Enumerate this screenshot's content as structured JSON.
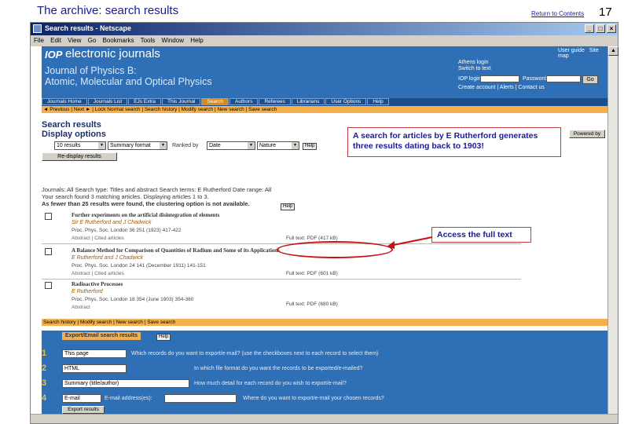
{
  "slide": {
    "title": "The archive: search results",
    "return_link": "Return to Contents",
    "page_number": "17"
  },
  "browser": {
    "window_title": "Search results - Netscape",
    "menu": [
      "File",
      "Edit",
      "View",
      "Go",
      "Bookmarks",
      "Tools",
      "Window",
      "Help"
    ]
  },
  "site": {
    "logo": "IOP",
    "brand": "electronic journals",
    "journal_line1": "Journal of Physics B:",
    "journal_line2": "Atomic, Molecular and Optical Physics",
    "top_links": [
      "User guide",
      "Site map"
    ],
    "login": {
      "heading": "Athens login",
      "switch": "Switch to text",
      "iop_login": "IOP login:",
      "password": "Password:",
      "go": "Go",
      "create": "Create account | Alerts | Contact us"
    }
  },
  "nav": {
    "tabs": [
      "Journals Home",
      "Journals List",
      "EJs Extra",
      "This Journal",
      "Search",
      "Authors",
      "Referees",
      "Librarians",
      "User Options",
      "Help"
    ],
    "active_tab": "Search",
    "subnav": "◄ Previous | Next ► | Lock Normal search | Search history | Modify search | New search | Save search"
  },
  "results": {
    "heading": "Search results",
    "display_heading": "Display options",
    "results_select": "10 results",
    "format_select": "Summary format",
    "ranked_label": "Ranked by",
    "rank_select": "Date",
    "order_select": "Nature",
    "help": "Help",
    "redisplay_button": "Re-display results",
    "powered_by": "Powered by",
    "summary_line1": "Journals: All  Search type: Titles and abstract  Search terms: E Rutherford  Date range: All",
    "summary_line2": "Your search found 3 matching articles. Displaying articles 1 to 3.",
    "summary_line3": "As fewer than 25 results were found, the clustering option is not available.",
    "articles": [
      {
        "title": "Further experiments on the artificial disintegration of elements",
        "authors": "Sir E Rutherford and J Chadwick",
        "citation": "Proc. Phys. Soc. London 36 251 (1923) 417-422",
        "links": "Abstract  |  Cited articles",
        "fulltext": "Full text: PDF (417 kB)"
      },
      {
        "title": "A Balance Method for Comparison of Quantities of Radium and Some of its Applications",
        "authors": "E Rutherford and J Chadwick",
        "citation": "Proc. Phys. Soc. London 24 141 (December 1911) 141-151",
        "links": "Abstract  |  Cited articles",
        "fulltext": "Full text: PDF (601 kB)"
      },
      {
        "title": "Radioactive Processes",
        "authors": "E Rutherford",
        "citation": "Proc. Phys. Soc. London 18 354 (June 1903) 354-360",
        "links": "Abstract",
        "fulltext": "Full text: PDF (680 kB)"
      }
    ],
    "bottom_nav": "Search history | Modify search | New search | Save search"
  },
  "export": {
    "tab": "Export/Email search results",
    "help": "Help",
    "rows": [
      {
        "n": "1",
        "select": "This page",
        "question": "Which records do you want to export/e-mail? (use the checkboxes next to each record to select them)"
      },
      {
        "n": "2",
        "select": "HTML",
        "question": "In which file format do you want the records to be exported/e-mailed?"
      },
      {
        "n": "3",
        "select": "Summary (title/author)",
        "question": "How much detail for each record do you wish to export/e-mail?"
      },
      {
        "n": "4",
        "select": "E-mail",
        "label": "E-mail address(es):",
        "question": "Where do you want to export/e-mail your chosen records?"
      }
    ],
    "button": "Export results"
  },
  "annotations": {
    "callout_search": "A search for articles by E Rutherford generates three results dating back to 1903!",
    "callout_fulltext": "Access the full text"
  },
  "colors": {
    "banner": "#2f6fb5",
    "accent_orange": "#f3b04c",
    "slide_title": "#1a1a99",
    "annotation_red": "#cc1010"
  }
}
